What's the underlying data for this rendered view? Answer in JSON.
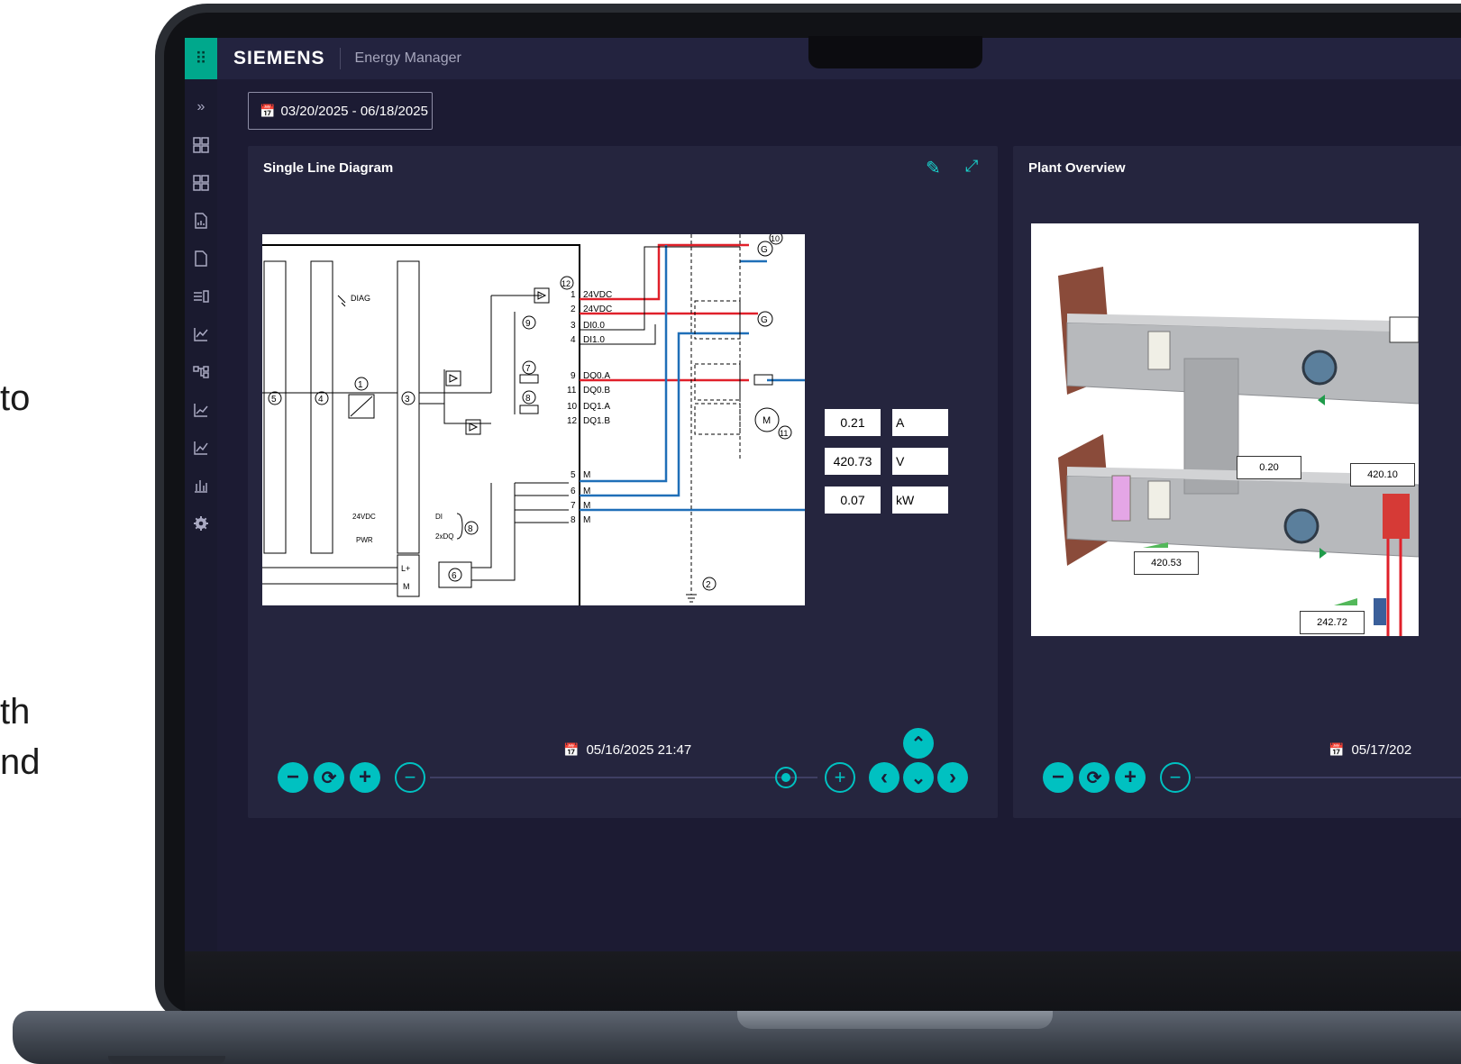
{
  "slide_text": {
    "line1": "to",
    "line2": "th",
    "line3": "nd"
  },
  "topbar": {
    "brand": "SIEMENS",
    "app_name": "Energy Manager",
    "launcher_icon": "grid-icon"
  },
  "sidebar": {
    "icons": [
      "expand-icon",
      "hierarchy-icon",
      "hierarchy-icon-2",
      "report-icon",
      "document-icon",
      "import-icon",
      "analytics-icon",
      "flow-icon",
      "trend-icon",
      "trend-icon-2",
      "bar-chart-icon",
      "settings-icon"
    ]
  },
  "date_range": {
    "label": "03/20/2025 - 06/18/2025"
  },
  "sld_panel": {
    "title": "Single Line Diagram",
    "readouts": [
      {
        "value": "0.21",
        "unit": "A"
      },
      {
        "value": "420.73",
        "unit": "V"
      },
      {
        "value": "0.07",
        "unit": "kW"
      }
    ],
    "timestamp": "05/16/2025 21:47",
    "diagram_labels": {
      "terminals": [
        "24VDC",
        "24VDC",
        "DI0.0",
        "DI1.0",
        "DQ0.A",
        "DQ0.B",
        "DQ1.A",
        "DQ1.B",
        "M",
        "M",
        "M",
        "M"
      ],
      "pins": [
        "1",
        "2",
        "3",
        "4",
        "9",
        "11",
        "10",
        "12",
        "5",
        "6",
        "7",
        "8"
      ],
      "circled": [
        "1",
        "2",
        "3",
        "4",
        "5",
        "6",
        "7",
        "8",
        "8",
        "9",
        "10",
        "11",
        "12"
      ],
      "diag": "DIAG",
      "left_labels": [
        "24VDC",
        "PWR"
      ],
      "io_labels": [
        "DI",
        "2xDQ"
      ],
      "bus": [
        "L+",
        "M"
      ],
      "g": "G",
      "m": "M"
    }
  },
  "plant_panel": {
    "title": "Plant Overview",
    "values": [
      "0.20",
      "420.10",
      "420.53",
      "242.72"
    ],
    "timestamp": "05/17/202"
  },
  "controls": {
    "minus": "−",
    "plus": "+",
    "reset": "⟳",
    "up": "⌃",
    "down": "⌄",
    "left": "‹",
    "right": "›"
  },
  "colors": {
    "background": "#1c1b33",
    "panel": "#25253e",
    "accent": "#00c1c1",
    "brand_green": "#00a88c",
    "wire_red": "#e0202a",
    "wire_blue": "#1f6fb8"
  }
}
